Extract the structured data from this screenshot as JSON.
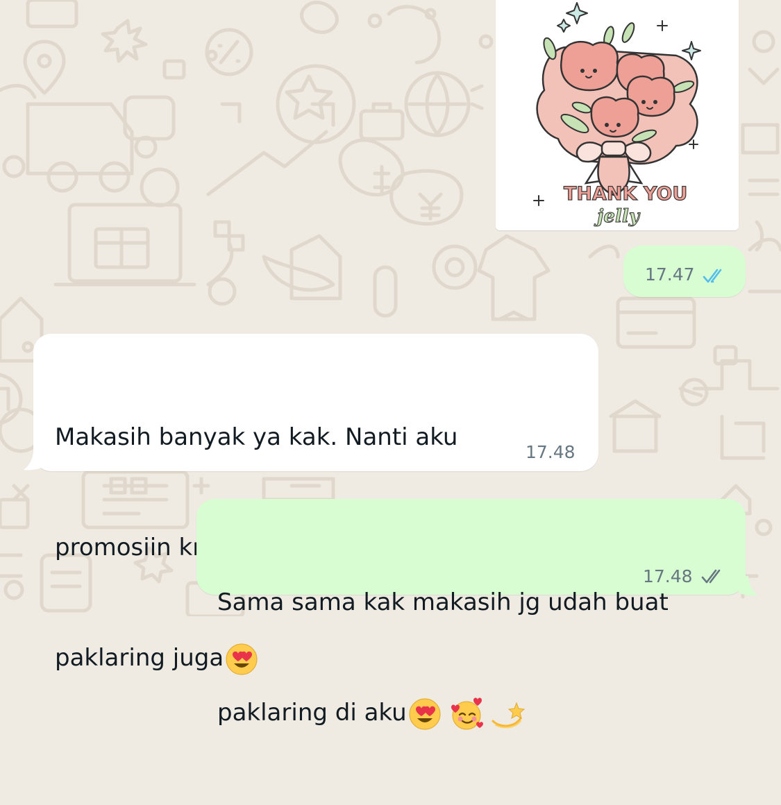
{
  "sticker": {
    "title": "THANK YOU",
    "subtitle": "jelly"
  },
  "messages": [
    {
      "direction": "outgoing",
      "time": "17.47",
      "status": "read"
    },
    {
      "direction": "incoming",
      "line1": "Makasih banyak ya kak. Nanti aku",
      "line2": "promosiin km ke tmn tmn aku yg butuh",
      "line3": "paklaring juga",
      "emojis": [
        "heart-eyes-emoji"
      ],
      "time": "17.48"
    },
    {
      "direction": "outgoing",
      "line1": "Sama sama kak makasih jg udah buat",
      "line2": "paklaring di aku",
      "emojis": [
        "heart-eyes-emoji",
        "smiling-face-with-hearts-emoji",
        "dizzy-emoji"
      ],
      "time": "17.48",
      "status": "delivered"
    }
  ],
  "colors": {
    "background": "#efeae2",
    "outgoing_bubble": "#d9fdd3",
    "incoming_bubble": "#ffffff",
    "read_tick": "#53bdeb",
    "sent_tick": "#667781"
  }
}
